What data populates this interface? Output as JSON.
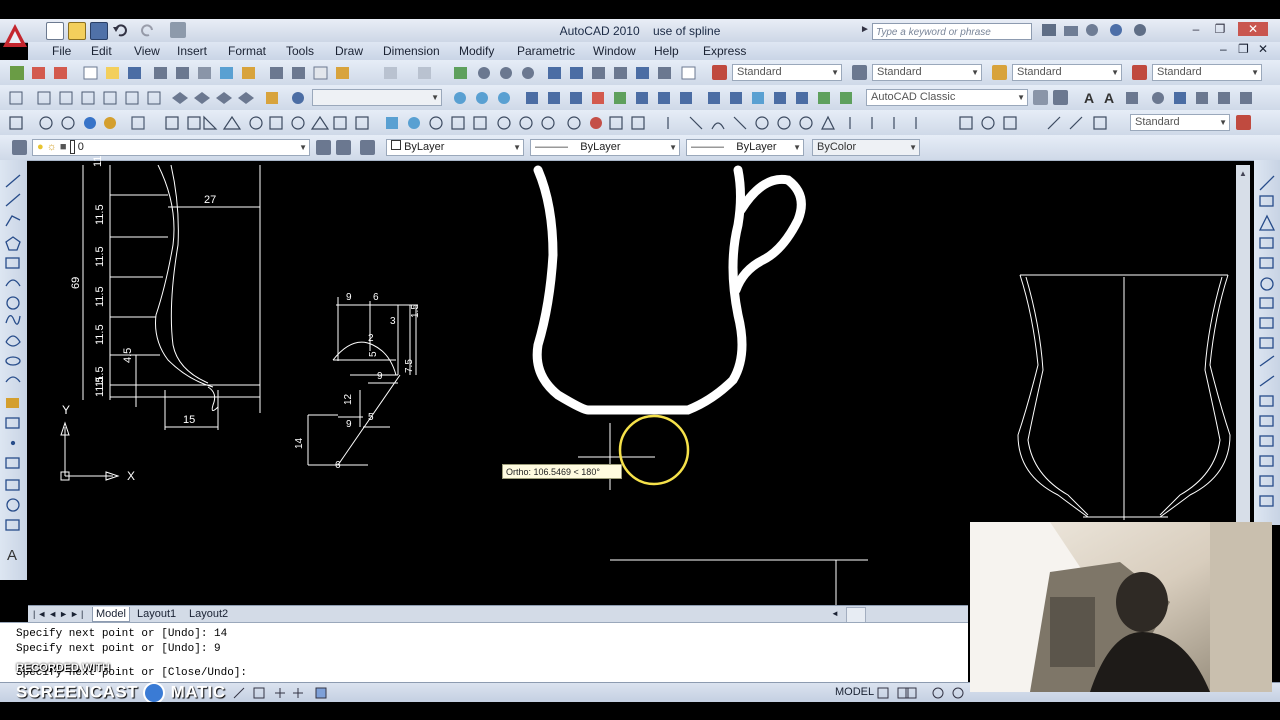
{
  "window": {
    "app_title": "AutoCAD 2010",
    "doc_title": "use of spline",
    "search_placeholder": "Type a keyword or phrase"
  },
  "menu": [
    "File",
    "Edit",
    "View",
    "Insert",
    "Format",
    "Tools",
    "Draw",
    "Dimension",
    "Modify",
    "Parametric",
    "Window",
    "Help",
    "Express"
  ],
  "toolbars": {
    "text_style": "Standard",
    "dim_style": "Standard",
    "table_style": "Standard",
    "mleader_style": "Standard",
    "workspace": "AutoCAD Classic",
    "view_style": "Standard",
    "layer": "0",
    "color": "ByLayer",
    "linetype": "ByLayer",
    "lineweight": "ByLayer",
    "plotstyle": "ByColor"
  },
  "drawing": {
    "dimensions": [
      "11.5",
      "11.5",
      "11.5",
      "11.5",
      "11.5",
      "11.5",
      "11.5",
      "69",
      "27",
      "15",
      "4.5",
      "9",
      "6",
      "1.5",
      "3",
      "2",
      "5",
      "7.5",
      "9",
      "12",
      "9",
      "5",
      "14",
      "6"
    ],
    "ucs_x": "X",
    "ucs_y": "Y",
    "tooltip": "Ortho: 106.5469 < 180°"
  },
  "tabs": [
    "Model",
    "Layout1",
    "Layout2"
  ],
  "command": {
    "line1": "Specify next point or [Undo]: 14",
    "line2": "Specify next point or [Undo]: 9",
    "line3": "Specify next point or [Close/Undo]:"
  },
  "status": {
    "model": "MODEL",
    "workspace": "AutoCAD Classic"
  },
  "watermark": {
    "line1": "RECORDED WITH",
    "line2": "SCREENCAST",
    "line3": "MATIC"
  },
  "colors": {
    "canvas": "#000000",
    "cursor_ring": "#f5e14a",
    "toolbar": "#cfd9e8",
    "logo": "#c4262e"
  }
}
